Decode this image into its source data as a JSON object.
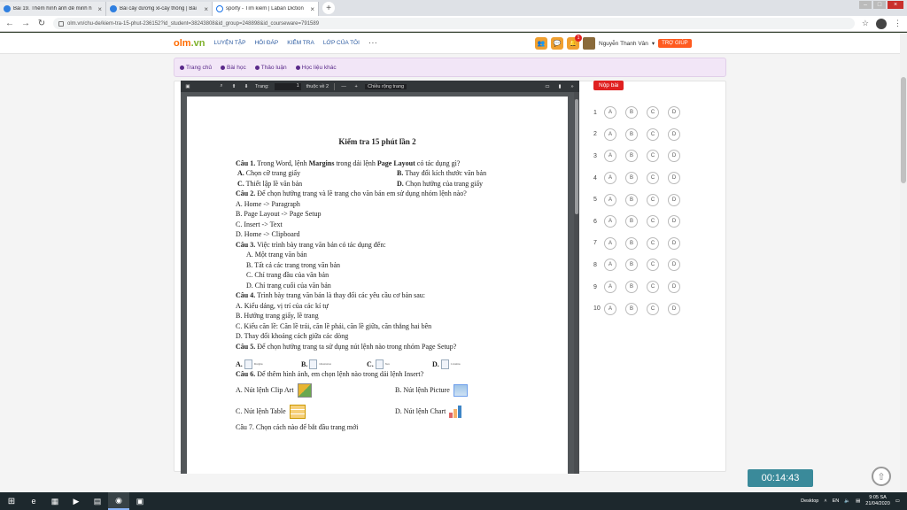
{
  "browser": {
    "tabs": [
      {
        "title": "Bài 19. Thêm hình ảnh để minh h",
        "active": false
      },
      {
        "title": "Bài cây dương xỉ-cây thông | Bài",
        "active": false
      },
      {
        "title": "sporty - Tìm kiếm | Laban Diction",
        "active": true
      }
    ],
    "new_tab": "+",
    "url": "olm.vn/chu-de/kiem-tra-15-phut-236152?id_student=38243808&id_group=248898&id_courseware=791589"
  },
  "site": {
    "logo_main": "olm",
    "logo_tld": ".vn",
    "nav": [
      "LUYỆN TẬP",
      "HỎI ĐÁP",
      "KIỂM TRA",
      "LỚP CỦA TÔI"
    ],
    "nav_more": "···",
    "notif_count": "1",
    "username": "Nguyễn Thanh Vân",
    "help": "TRỢ GIÚP",
    "subnav": [
      "Trang chủ",
      "Bài học",
      "Thảo luận",
      "Học liệu khác"
    ]
  },
  "pdf_toolbar": {
    "page_label": "Trang:",
    "page_value": "1",
    "page_total": "thuộc về 2",
    "zoom_out": "—",
    "zoom_in": "+",
    "zoom": "Chiều rộng trang"
  },
  "doc": {
    "title": "Kiểm tra 15 phút lần 2",
    "q1": {
      "label": "Câu 1.",
      "text_a": " Trong Word, lệnh ",
      "b1": "Margins",
      "text_b": " trong dải lệnh ",
      "b2": "Page Layout",
      "text_c": " có tác dụng gì?",
      "a": "A.",
      "a_t": " Chọn cỡ trang giấy",
      "b": "B.",
      "b_t": " Thay đổi kích thước văn bản",
      "c": "C.",
      "c_t": " Thiết lập lề văn bản",
      "d": "D.",
      "d_t": " Chọn hướng của trang giấy"
    },
    "q2": {
      "label": "Câu 2.",
      "text": " Để chọn hướng trang và lề trang cho văn bản em sử dụng nhóm lệnh nào?",
      "a": "A. Home -> Paragraph",
      "b": "B. Page Layout -> Page Setup",
      "c": "C. Insert -> Text",
      "d": "D. Home -> Clipboard"
    },
    "q3": {
      "label": "Câu 3.",
      "text": " Việc trình bày trang văn bản có tác dụng đến:",
      "a": "A.  Một trang văn bản",
      "b": "B.  Tất cả các trang trong văn bản",
      "c": "C.  Chỉ trang đầu của văn bản",
      "d": "D.  Chỉ trang cuối của văn bản"
    },
    "q4": {
      "label": "Câu 4.",
      "text": " Trình bày trang văn bản là thay đổi các yêu cầu cơ bản sau:",
      "a": "A. Kiểu dáng, vị trí của các kí tự",
      "b": "B. Hướng trang giấy, lề trang",
      "c": "C. Kiểu căn lề: Căn lề trái, căn lề phải, căn lề giữa, căn thẳng hai bên",
      "d": "D. Thay đổi khoảng cách giữa các dòng"
    },
    "q5": {
      "label": "Câu 5.",
      "text": " Để chọn hướng trang ta sử dụng nút lệnh nào trong nhóm Page Setup?",
      "a": "A.",
      "b": "B.",
      "c": "C.",
      "d": "D.",
      "a_icon": "Margins",
      "b_icon": "Orientation",
      "c_icon": "Size",
      "d_icon": "Columns"
    },
    "q6": {
      "label": "Câu 6.",
      "text": " Để thêm hình ảnh, em chọn lệnh nào trong dải lệnh Insert?",
      "a": "A. Nút lệnh Clip Art",
      "b": "B. Nút lệnh Picture",
      "c": "C. Nút lệnh Table",
      "d": "D. Nút lệnh Chart"
    },
    "q7_partial": "Câu 7. Chọn cách nào để bắt đầu trang mới"
  },
  "answer_sheet": {
    "submit": "Nộp bài",
    "options": [
      "A",
      "B",
      "C",
      "D"
    ],
    "questions": [
      "1",
      "2",
      "3",
      "4",
      "5",
      "6",
      "7",
      "8",
      "9",
      "10"
    ]
  },
  "timer": "00:14:43",
  "taskbar": {
    "desktop": "Desktop",
    "lang": "EN",
    "time": "9:05 SA",
    "date": "21/04/2020"
  }
}
